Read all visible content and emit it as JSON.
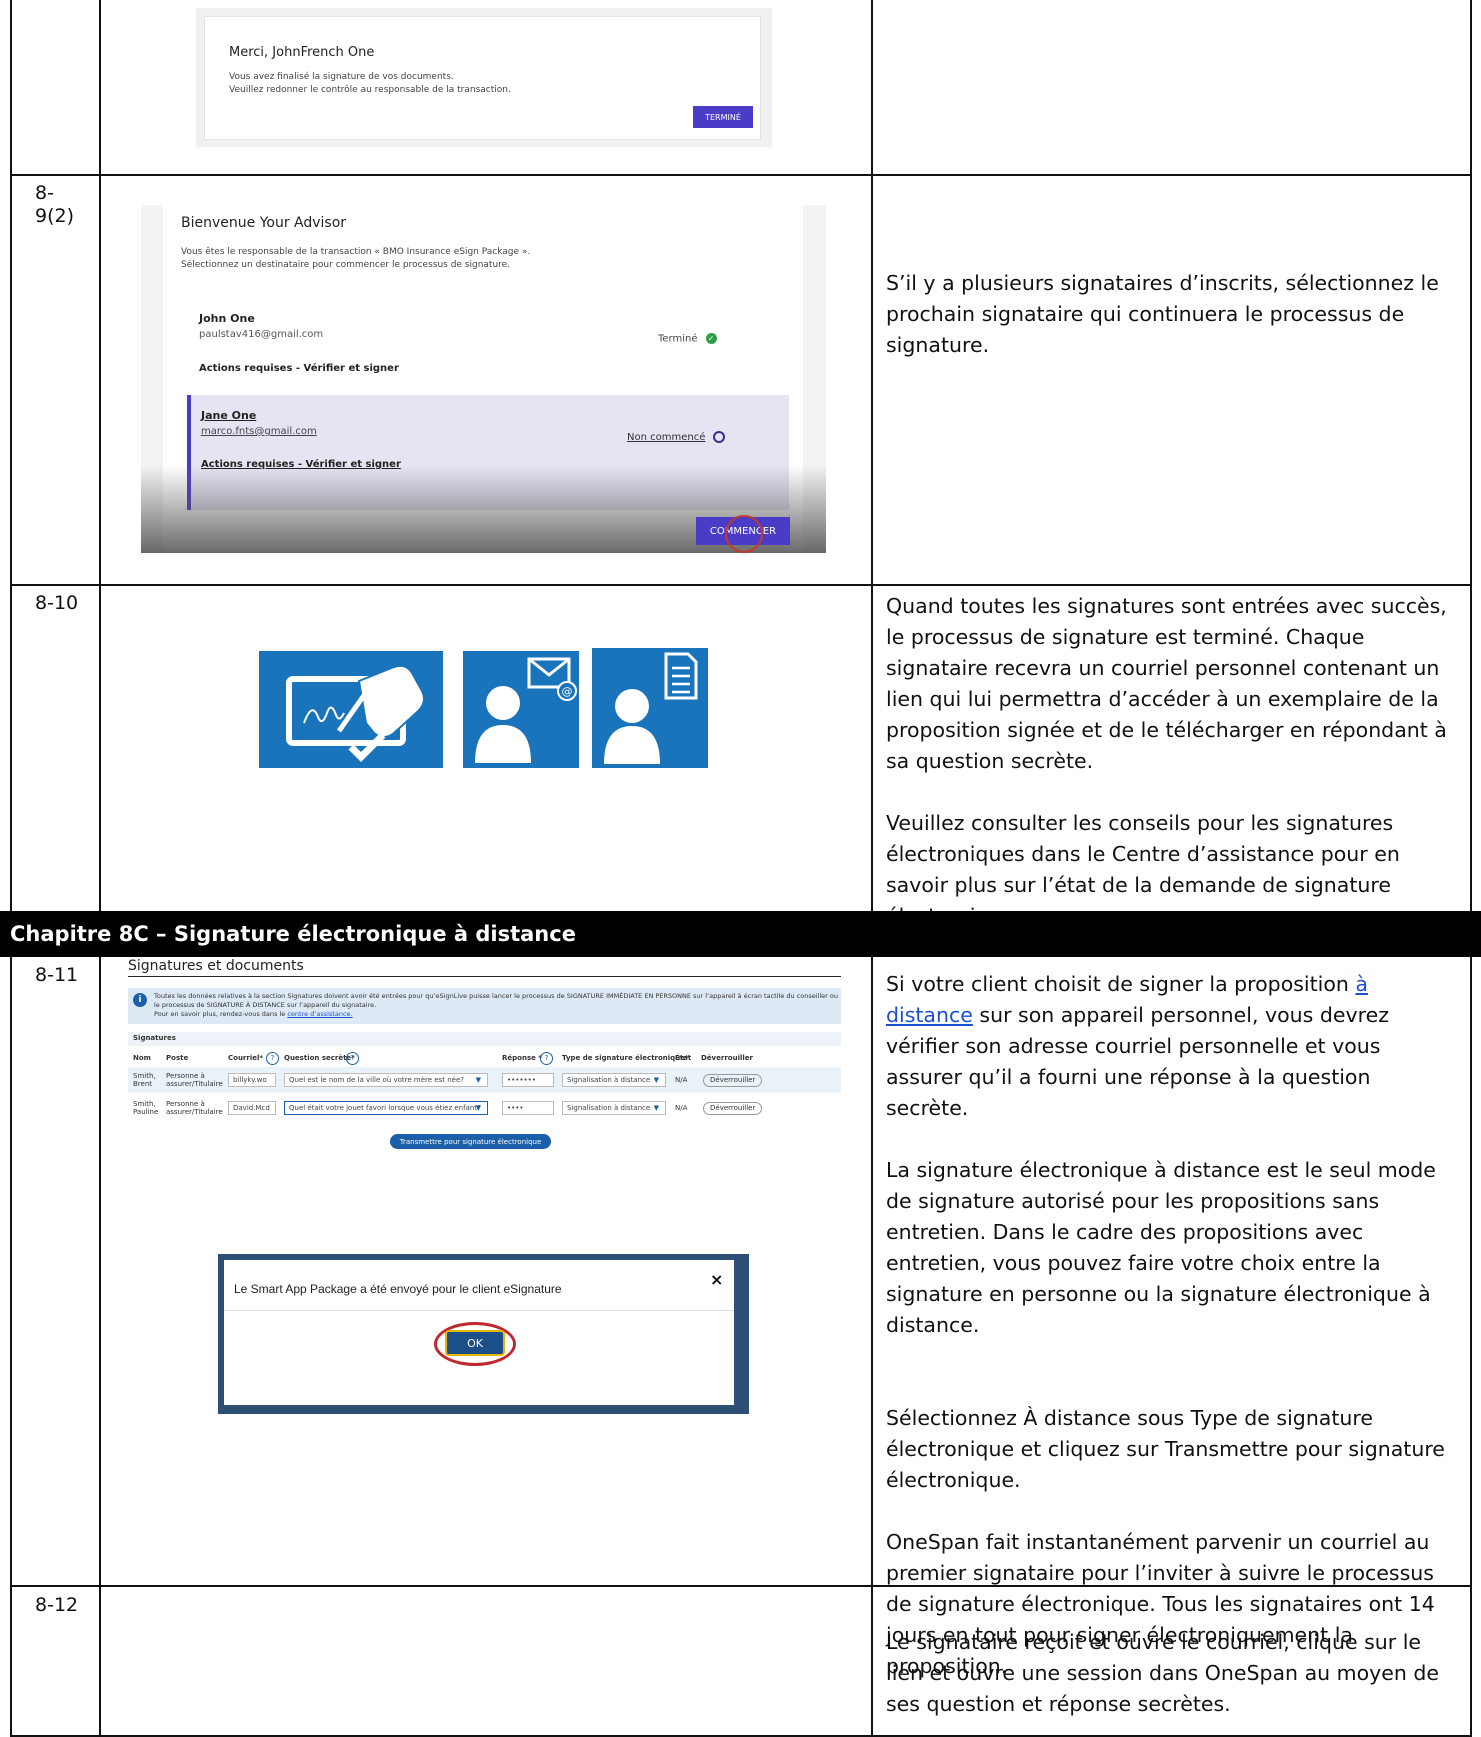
{
  "rows": [
    {
      "step": "",
      "description": []
    },
    {
      "step_line1": "8-",
      "step_line2": "9(2)",
      "description": "S’il y a plusieurs signataires d’inscrits, sélectionnez le prochain signataire qui continuera le processus de signature."
    },
    {
      "step": "8-10",
      "para1": "Quand toutes les signatures sont entrées avec succès, le processus de signature est terminé. Chaque signataire recevra un courriel personnel contenant un lien qui lui permettra d’accéder à un exemplaire de la proposition signée et de le télécharger en répondant à sa question secrète.",
      "para2": "Veuillez consulter les conseils pour les signatures électroniques dans le Centre d’assistance pour en savoir plus sur l’état de la demande de signature électronique."
    },
    {
      "step": "8-11",
      "para1_pre": "Si votre client choisit de signer la proposition ",
      "para1_link": "à distance",
      "para1_post": " sur son appareil personnel, vous devrez vérifier son adresse courriel personnelle et vous assurer qu’il a fourni une réponse à la question secrète.",
      "para2": "La signature électronique à distance est le seul mode de signature autorisé pour les propositions sans entretien. Dans le cadre des propositions avec entretien, vous pouvez faire votre choix entre la signature en personne ou la signature électronique à distance.",
      "para3": "Sélectionnez À distance sous Type de signature électronique et cliquez sur Transmettre pour signature électronique.",
      "para4": "OneSpan fait instantanément parvenir un courriel au premier signataire pour l’inviter à suivre le processus de signature électronique. Tous les signataires ont 14 jours en tout pour signer électroniquement la proposition."
    },
    {
      "step": "8-12",
      "description": "Le signataire reçoit et ouvre le courriel, clique sur le lien et ouvre une session dans OneSpan au moyen de ses question et réponse secrètes."
    }
  ],
  "chapter_title": "Chapitre 8C – Signature électronique à distance",
  "shot_merci": {
    "title": "Merci, JohnFrench One",
    "line1": "Vous avez finalisé la signature de vos documents.",
    "line2": "Veuillez redonner le contrôle au responsable de la transaction.",
    "button": "TERMINÉ"
  },
  "shot_bienvenue": {
    "title": "Bienvenue Your Advisor",
    "line1": "Vous êtes le responsable de la transaction « BMO Insurance eSign Package ».",
    "line2": "Sélectionnez un destinataire pour commencer le processus de signature.",
    "signer1_name": "John One",
    "signer1_email": "paulstav416@gmail.com",
    "signer1_status": "Terminé",
    "signer1_actions": "Actions requises - Vérifier et signer",
    "signer2_name": "Jane One",
    "signer2_email": "marco.fnts@gmail.com",
    "signer2_status": "Non commencé",
    "signer2_actions": "Actions requises - Vérifier et signer",
    "button": "COMMENCER"
  },
  "shot_signatures": {
    "title": "Signatures et documents",
    "info1": "Toutes les données relatives à la section Signatures doivent avoir été entrées pour qu’eSignLive puisse lancer le processus de SIGNATURE IMMÉDIATE EN PERSONNE sur l’appareil à écran tactile du conseiller ou",
    "info2": "le processus de SIGNATURE À DISTANCE sur l’appareil du signataire.",
    "info3_pre": "Pour en savoir plus, rendez-vous dans le ",
    "info3_link": "centre d’assistance.",
    "section": "Signatures",
    "headers": [
      "Nom",
      "Poste",
      "Courriel*",
      "Question secrète*",
      "Réponse *",
      "Type de signature électronique*",
      "État",
      "Déverrouiller"
    ],
    "rows": [
      {
        "nom1": "Smith,",
        "nom2": "Brent",
        "poste1": "Personne à",
        "poste2": "assurer/Titulaire",
        "courriel": "billyky.wo",
        "question": "Quel est le nom de la ville où votre mère est née?",
        "reponse": "•••••••",
        "type": "Signalisation à distance",
        "etat": "N/A",
        "btn": "Déverrouiller"
      },
      {
        "nom1": "Smith,",
        "nom2": "Pauline",
        "poste1": "Personne à",
        "poste2": "assurer/Titulaire",
        "courriel": "David.Mcd",
        "question": "Quel était votre jouet favori lorsque vous étiez enfant?",
        "reponse": "••••",
        "type": "Signalisation à distance",
        "etat": "N/A",
        "btn": "Déverrouiller"
      }
    ],
    "submit": "Transmettre pour signature électronique"
  },
  "dialog": {
    "message": "Le Smart App Package a été envoyé pour le client eSignature",
    "ok": "OK",
    "close": "×"
  },
  "colors": {
    "accent_purple": "#4b3cc8",
    "icon_blue": "#1a74bb",
    "chapter_bar": "#000000",
    "link": "#1a4fd6"
  }
}
